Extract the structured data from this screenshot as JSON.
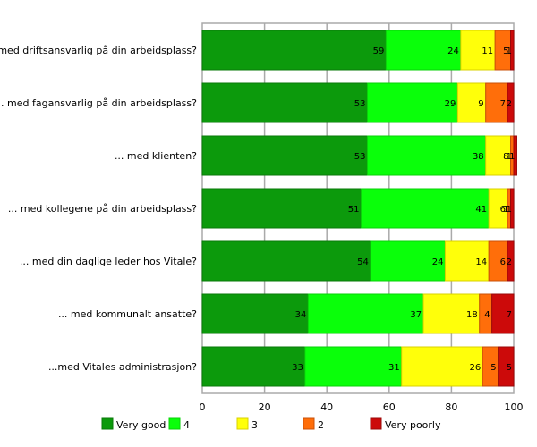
{
  "chart_data": {
    "type": "bar",
    "orientation": "horizontal",
    "stacked": true,
    "title": "",
    "xlabel": "",
    "ylabel": "",
    "xlim": [
      0,
      100
    ],
    "x_ticks": [
      "0",
      "20",
      "40",
      "60",
      "80",
      "100"
    ],
    "grid": true,
    "legend_position": "bottom",
    "categories": [
      "... med driftsansvarlig på din arbeidsplass?",
      "... med fagansvarlig på din arbeidsplass?",
      "... med klienten?",
      "... med kollegene på din arbeidsplass?",
      "... med din daglige leder hos Vitale?",
      "... med kommunalt ansatte?",
      "...med Vitales administrasjon?"
    ],
    "series": [
      {
        "name": "Very good",
        "color": "#0c9a0c",
        "border": "#0a7a0a",
        "values": [
          59,
          53,
          53,
          51,
          54,
          34,
          33
        ]
      },
      {
        "name": "4",
        "color": "#0aff0a",
        "border": "#0ad00a",
        "values": [
          24,
          29,
          38,
          41,
          24,
          37,
          31
        ]
      },
      {
        "name": "3",
        "color": "#ffff0a",
        "border": "#d8d000",
        "values": [
          11,
          9,
          8,
          6,
          14,
          18,
          26
        ]
      },
      {
        "name": "2",
        "color": "#ff6e0a",
        "border": "#c85008",
        "values": [
          5,
          7,
          1,
          1,
          6,
          4,
          5
        ]
      },
      {
        "name": "Very poorly",
        "color": "#cc0a0a",
        "border": "#9a0808",
        "values": [
          1,
          2,
          1,
          1,
          2,
          7,
          5
        ]
      }
    ]
  }
}
